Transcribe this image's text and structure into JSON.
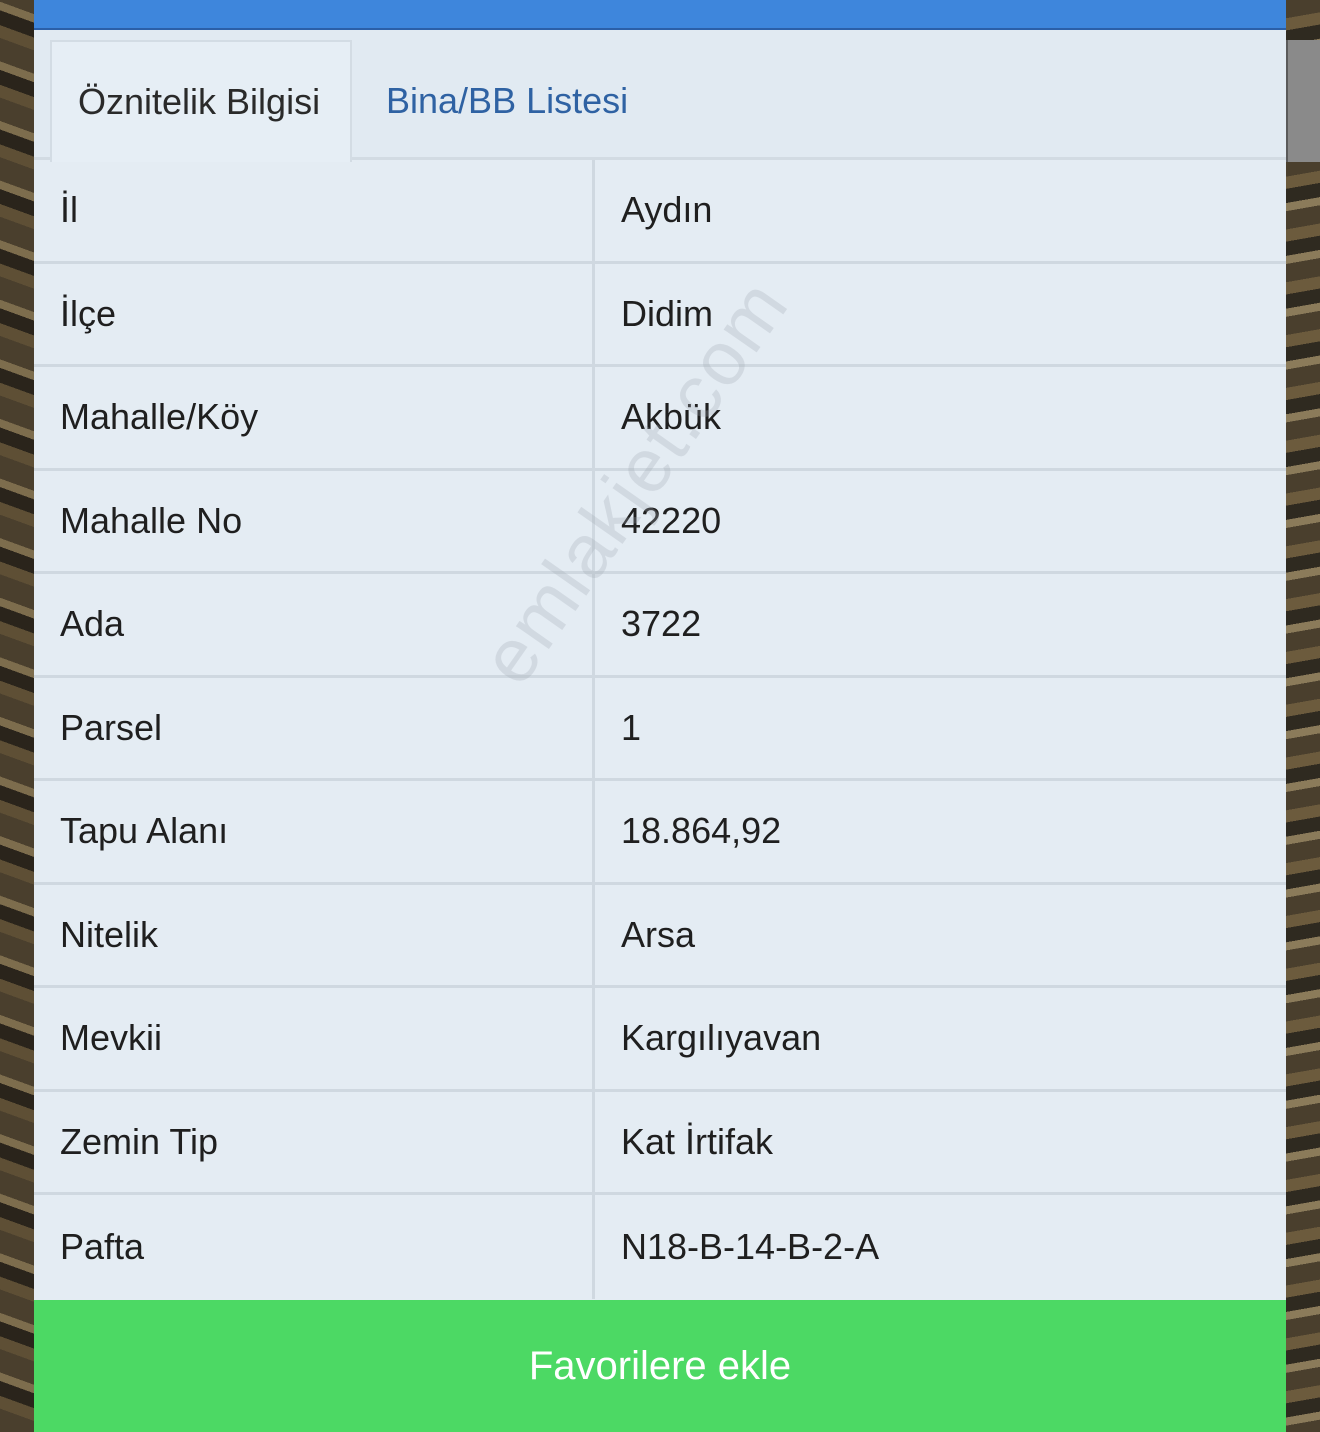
{
  "tabs": [
    {
      "label": "Öznitelik Bilgisi",
      "active": true
    },
    {
      "label": "Bina/BB Listesi",
      "active": false
    }
  ],
  "rows": [
    {
      "key": "İl",
      "value": "Aydın"
    },
    {
      "key": "İlçe",
      "value": "Didim"
    },
    {
      "key": "Mahalle/Köy",
      "value": "Akbük"
    },
    {
      "key": "Mahalle No",
      "value": "42220"
    },
    {
      "key": "Ada",
      "value": "3722"
    },
    {
      "key": "Parsel",
      "value": "1"
    },
    {
      "key": "Tapu Alanı",
      "value": "18.864,92"
    },
    {
      "key": "Nitelik",
      "value": "Arsa"
    },
    {
      "key": "Mevkii",
      "value": "Kargılıyavan"
    },
    {
      "key": "Zemin Tip",
      "value": "Kat İrtifak"
    },
    {
      "key": "Pafta",
      "value": "N18-B-14-B-2-A"
    }
  ],
  "watermark": "emlakjet.com",
  "button": {
    "label": "Favorilere ekle"
  },
  "colors": {
    "topbar": "#3e86dc",
    "panel": "#e4ecf3",
    "tab_link": "#2f62a3",
    "button": "#4cd964"
  }
}
